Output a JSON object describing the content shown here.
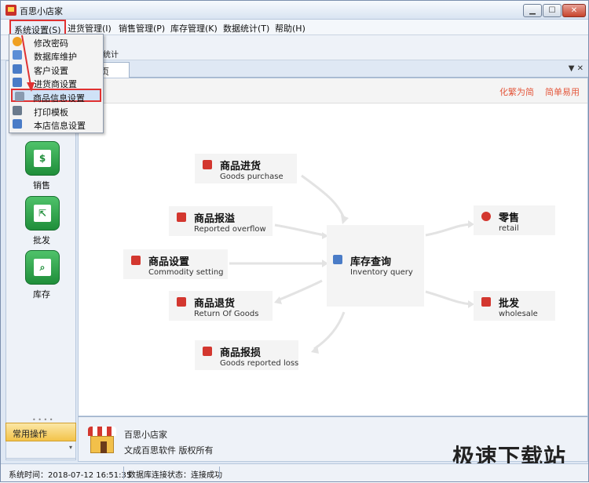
{
  "window": {
    "title": "百思小店家"
  },
  "menu": {
    "items": [
      {
        "label": "系统设置(S)"
      },
      {
        "label": "进货管理(I)"
      },
      {
        "label": "销售管理(P)"
      },
      {
        "label": "库存管理(K)"
      },
      {
        "label": "数据统计(T)"
      },
      {
        "label": "帮助(H)"
      }
    ]
  },
  "toolbar": {
    "partial_text": "统计"
  },
  "dropdown": {
    "items": [
      {
        "label": "修改密码",
        "icon": "key-icon"
      },
      {
        "label": "数据库维护",
        "icon": "database-icon"
      },
      {
        "label": "客户设置",
        "icon": "customer-icon"
      },
      {
        "label": "进货商设置",
        "icon": "supplier-icon"
      },
      {
        "label": "商品信息设置",
        "icon": "product-icon"
      },
      {
        "label": "打印模板",
        "icon": "print-icon"
      },
      {
        "label": "本店信息设置",
        "icon": "store-icon"
      }
    ],
    "highlighted_index": 4
  },
  "tabs": {
    "active_label": "页"
  },
  "sidebar": {
    "items": [
      {
        "label": "销售"
      },
      {
        "label": "批发"
      },
      {
        "label": "库存"
      }
    ],
    "common_ops": "常用操作"
  },
  "main": {
    "modes": {
      "complex": "化繁为简",
      "simple": "简单易用"
    },
    "nodes": {
      "purchase": {
        "cn": "商品进货",
        "en": "Goods purchase"
      },
      "overflow": {
        "cn": "商品报溢",
        "en": "Reported overflow"
      },
      "commodity": {
        "cn": "商品设置",
        "en": "Commodity setting"
      },
      "return": {
        "cn": "商品退货",
        "en": "Return Of Goods"
      },
      "loss": {
        "cn": "商品报损",
        "en": "Goods reported loss"
      },
      "inventory": {
        "cn": "库存查询",
        "en": "Inventory query"
      },
      "retail": {
        "cn": "零售",
        "en": "retail"
      },
      "wholesale": {
        "cn": "批发",
        "en": "wholesale"
      }
    }
  },
  "footer": {
    "line1": "百思小店家",
    "line2": "文成百思软件  版权所有"
  },
  "watermark": "极速下载站",
  "status": {
    "time": "系统时间：2018-07-12 16:51:35",
    "db": "数据库连接状态：连接成功"
  },
  "colors": {
    "highlight_red": "#e03131",
    "accent_orange": "#e4583d",
    "nav_green": "#1f8e3a"
  }
}
